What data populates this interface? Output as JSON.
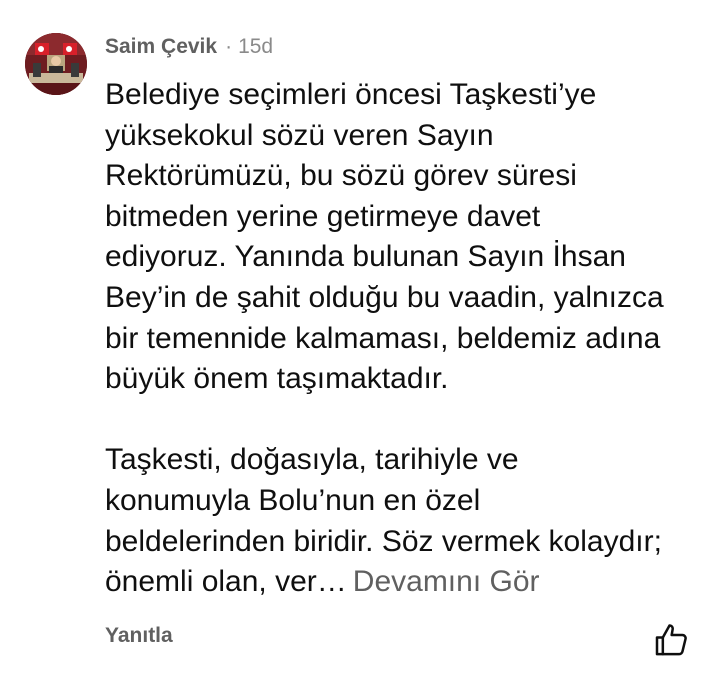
{
  "comment": {
    "author": "Saim Çevik",
    "separator": "·",
    "age": "15d",
    "lines": [
      "Belediye seçimleri öncesi Taşkesti’ye",
      "yüksekokul sözü veren Sayın",
      "Rektörümüzü, bu sözü görev süresi",
      "bitmeden yerine getirmeye davet",
      "ediyoruz. Yanında bulunan Sayın İhsan",
      "Bey’in de şahit olduğu bu vaadin, yalnızca",
      "bir temennide kalmaması, beldemiz adına",
      "büyük önem taşımaktadır.",
      "Taşkesti, doğasıyla, tarihiyle ve",
      "konumuyla Bolu’nun en özel",
      "beldelerinden biridir. Söz vermek kolaydır;",
      "önemli olan, ver…"
    ],
    "read_more": "Devamını Gör"
  },
  "actions": {
    "reply_label": "Yanıtla",
    "like_icon": "thumbs-up-icon"
  },
  "avatar": {
    "icon": "profile-photo",
    "colors": {
      "backdrop": "#7a2226",
      "flag": "#d8202a",
      "desk": "#c9b89a"
    }
  },
  "colors": {
    "text": "#0f0f0f",
    "secondary": "#606060",
    "muted": "#8a8a8a"
  }
}
